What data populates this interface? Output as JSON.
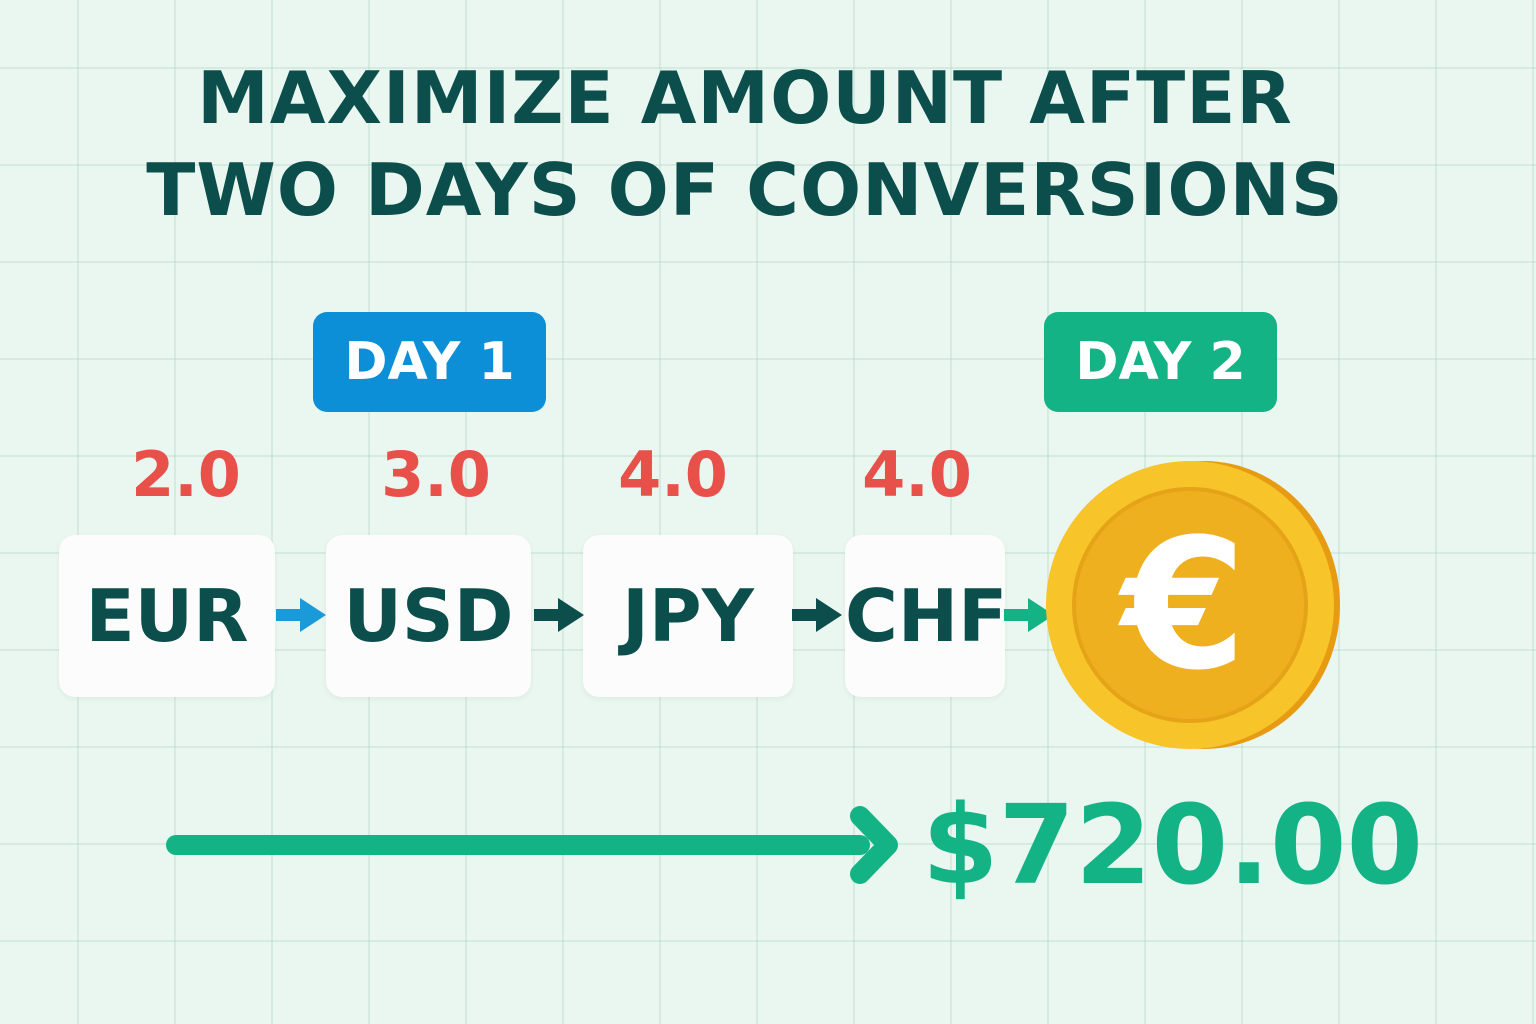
{
  "title": {
    "line1": "MAXIMIZE AMOUNT AFTER",
    "line2": "TWO DAYS OF CONVERSIONS"
  },
  "days": [
    {
      "label": "DAY 1",
      "color": "#0d8fd8"
    },
    {
      "label": "DAY 2",
      "color": "#13b385"
    }
  ],
  "rates": [
    "2.0",
    "3.0",
    "4.0",
    "4.0"
  ],
  "currencies": [
    "EUR",
    "USD",
    "JPY",
    "CHF"
  ],
  "coin_symbol": "€",
  "total": "$720.00",
  "colors": {
    "title": "#0b4e4c",
    "rate": "#e8504a",
    "currency_text": "#0b4e4c",
    "arrow_day1": "#1a9ad8",
    "arrow_dark": "#0b4e4c",
    "arrow_day2": "#13b385",
    "total": "#13b385",
    "coin_gold": "#f3b521"
  },
  "icons": {
    "arrows": [
      "right-arrow-icon",
      "right-arrow-icon",
      "right-arrow-icon",
      "right-arrow-icon"
    ],
    "coin": "euro-coin-icon",
    "long_arrow": "long-right-arrow-icon"
  }
}
